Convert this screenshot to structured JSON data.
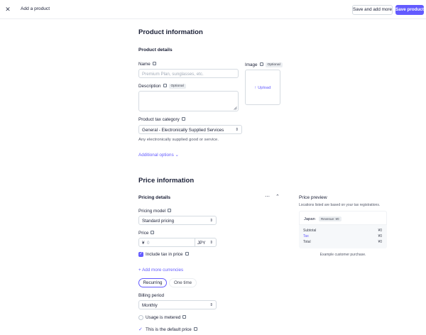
{
  "topbar": {
    "title": "Add a product",
    "save_and_add_more": "Save and add more",
    "save_product": "Save product"
  },
  "product_info": {
    "heading": "Product information",
    "details_heading": "Product details",
    "name_label": "Name",
    "name_placeholder": "Premium Plan, sunglasses, etc.",
    "description_label": "Description",
    "description_badge": "Optional",
    "image_label": "Image",
    "image_badge": "Optional",
    "upload_label": "Upload",
    "tax_category_label": "Product tax category",
    "tax_category_value": "General - Electronically Supplied Services",
    "tax_category_help": "Any electronically supplied good or service.",
    "additional_options": "Additional options"
  },
  "price_info": {
    "heading": "Price information",
    "pricing_details_heading": "Pricing details",
    "pricing_model_label": "Pricing model",
    "pricing_model_value": "Standard pricing",
    "price_label": "Price",
    "currency_symbol": "¥",
    "price_placeholder": "0",
    "currency_code": "JPY",
    "include_tax_label": "Include tax in price",
    "add_currencies": "Add more currencies",
    "recurring": "Recurring",
    "one_time": "One time",
    "billing_period_label": "Billing period",
    "billing_period_value": "Monthly",
    "usage_metered_label": "Usage is metered",
    "default_price_label": "This is the default price"
  },
  "preview": {
    "heading": "Price preview",
    "subheading": "Locations listed are based on your tax registrations.",
    "country": "Japan",
    "revenue_badge": "Revenue: ¥0",
    "subtotal_label": "Subtotal",
    "subtotal_value": "¥0",
    "tax_label": "Tax",
    "tax_value": "¥0",
    "total_label": "Total",
    "total_value": "¥0",
    "footnote": "Example customer purchase."
  },
  "colors": {
    "accent": "#635bff",
    "text": "#1a1f36",
    "border": "#d5dbe1"
  }
}
